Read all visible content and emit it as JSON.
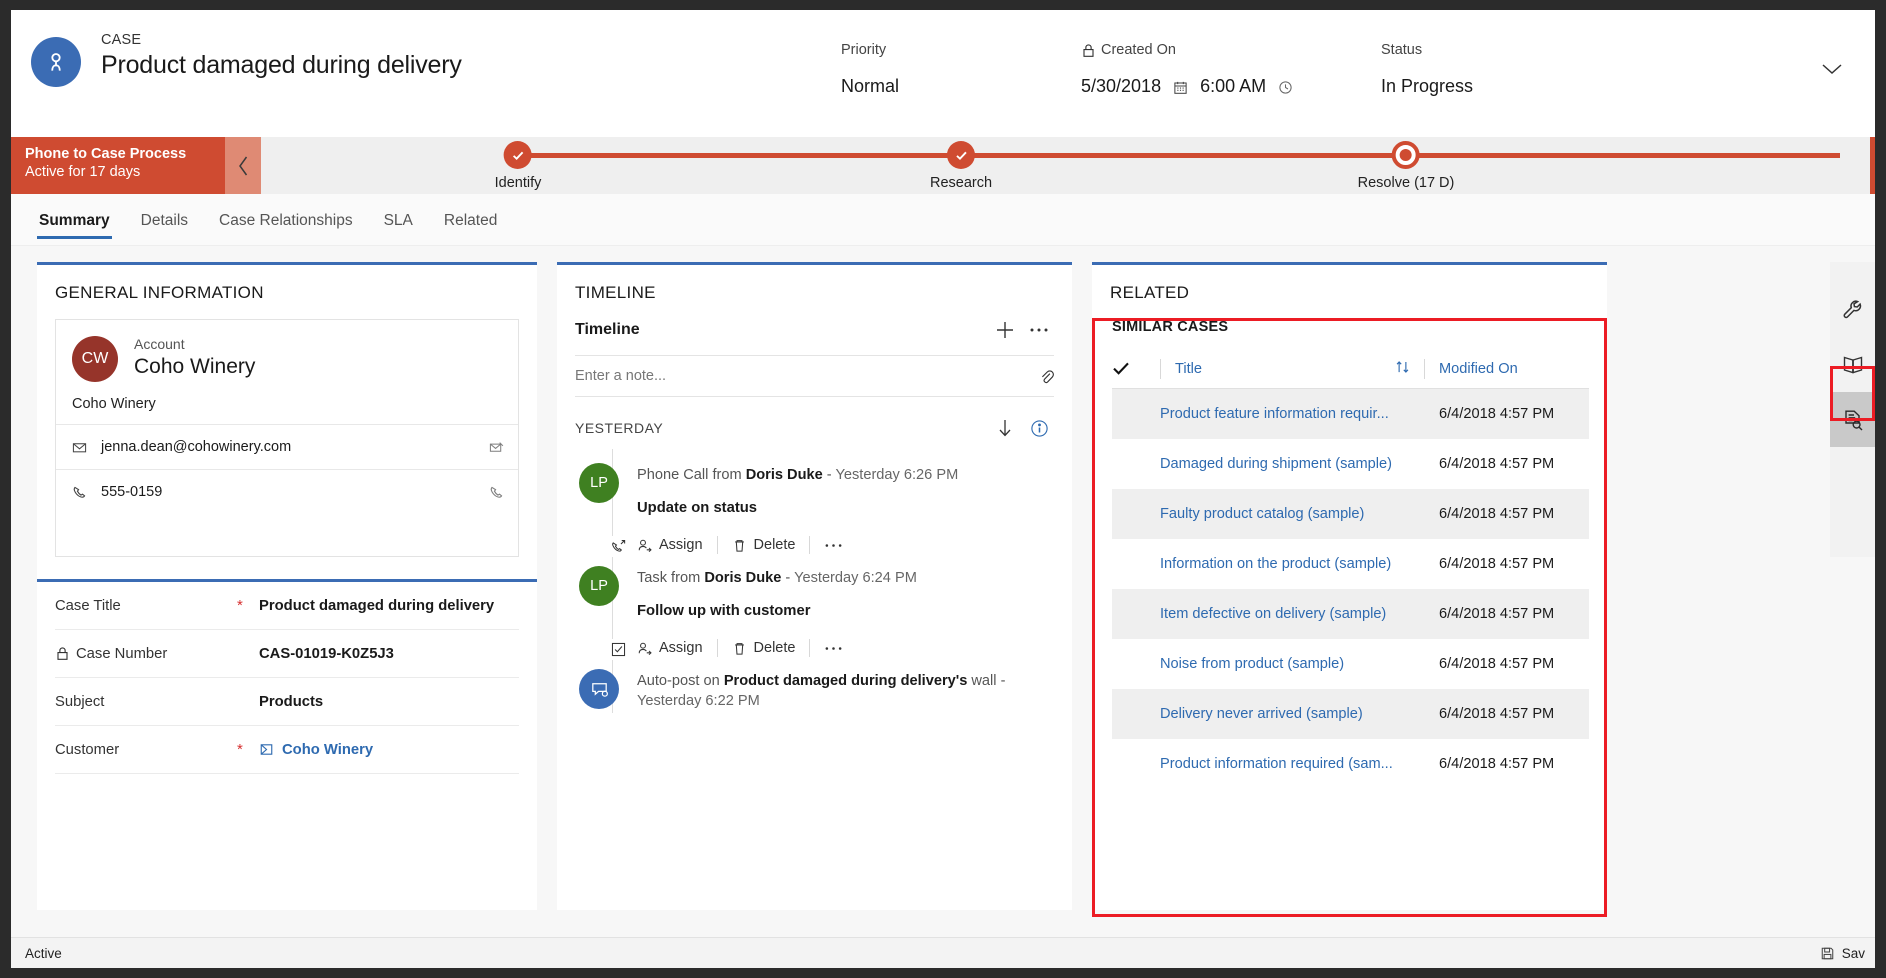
{
  "header": {
    "eyebrow": "CASE",
    "title": "Product damaged during delivery",
    "avatar_icon": "case-person-icon",
    "fields": {
      "priority_label": "Priority",
      "priority_value": "Normal",
      "created_label": "Created On",
      "created_date": "5/30/2018",
      "created_time": "6:00 AM",
      "status_label": "Status",
      "status_value": "In Progress"
    },
    "collapse_icon": "chevron-down-icon"
  },
  "process": {
    "name": "Phone to Case Process",
    "duration": "Active for 17 days",
    "collapse_icon": "chevron-left-icon",
    "accent_color": "#cf4b31",
    "stages": [
      {
        "label": "Identify",
        "state": "complete"
      },
      {
        "label": "Research",
        "state": "complete"
      },
      {
        "label": "Resolve  (17 D)",
        "state": "active"
      }
    ]
  },
  "tabs": [
    {
      "label": "Summary",
      "active": true
    },
    {
      "label": "Details",
      "active": false
    },
    {
      "label": "Case Relationships",
      "active": false
    },
    {
      "label": "SLA",
      "active": false
    },
    {
      "label": "Related",
      "active": false
    }
  ],
  "general_information": {
    "section_title": "GENERAL INFORMATION",
    "account": {
      "initials": "CW",
      "label": "Account",
      "name": "Coho Winery",
      "sub_name": "Coho Winery",
      "email": "jenna.dean@cohowinery.com",
      "phone": "555-0159",
      "email_icon": "envelope-icon",
      "email_action_icon": "send-email-icon",
      "phone_icon": "phone-icon",
      "phone_action_icon": "call-icon",
      "avatar_color": "#96342a"
    },
    "form_rows": [
      {
        "label": "Case Title",
        "required": true,
        "value": "Product damaged during delivery",
        "locked": false,
        "link": false
      },
      {
        "label": "Case Number",
        "required": false,
        "value": "CAS-01019-K0Z5J3",
        "locked": true,
        "link": false
      },
      {
        "label": "Subject",
        "required": false,
        "value": "Products",
        "locked": false,
        "link": false
      },
      {
        "label": "Customer",
        "required": true,
        "value": "Coho Winery",
        "locked": false,
        "link": true
      }
    ]
  },
  "timeline": {
    "section_title": "TIMELINE",
    "panel_title": "Timeline",
    "add_icon": "plus-icon",
    "more_icon": "ellipsis-icon",
    "note_placeholder": "Enter a note...",
    "attach_icon": "paperclip-icon",
    "day_group": "YESTERDAY",
    "sort_icon": "arrow-down-icon",
    "info_icon": "info-icon",
    "entries": [
      {
        "initials": "LP",
        "avatar_color": "#3f8021",
        "badge_icon": "phone-outgoing-icon",
        "prefix": "Phone Call from ",
        "actor": "Doris Duke",
        "dash": " - ",
        "time": "Yesterday 6:26 PM",
        "subject": "Update on status",
        "assign_label": "Assign",
        "delete_label": "Delete",
        "assign_icon": "assign-person-icon",
        "delete_icon": "trash-icon",
        "more_icon": "ellipsis-icon"
      },
      {
        "initials": "LP",
        "avatar_color": "#3f8021",
        "badge_icon": "task-checkbox-icon",
        "prefix": "Task from ",
        "actor": "Doris Duke",
        "dash": " - ",
        "time": "Yesterday 6:24 PM",
        "subject": "Follow up with customer",
        "assign_label": "Assign",
        "delete_label": "Delete",
        "assign_icon": "assign-person-icon",
        "delete_icon": "trash-icon",
        "more_icon": "ellipsis-icon"
      },
      {
        "initials": "",
        "avatar_color": "#3b6cb4",
        "badge_icon": "auto-post-icon",
        "prefix": "Auto-post on ",
        "actor": "Product damaged during delivery's",
        "dash": " wall - ",
        "time": "Yesterday 6:22 PM",
        "subject": "",
        "assign_label": "",
        "delete_label": "",
        "assign_icon": "",
        "delete_icon": "",
        "more_icon": ""
      }
    ]
  },
  "related": {
    "section_title": "RELATED",
    "similar_cases_title": "SIMILAR CASES",
    "columns": {
      "check_icon": "checkmark-icon",
      "title": "Title",
      "sort_icon": "sort-updown-icon",
      "modified_on": "Modified On"
    },
    "rows": [
      {
        "title": "Product feature information requir...",
        "modified_on": "6/4/2018 4:57 PM"
      },
      {
        "title": "Damaged during shipment (sample)",
        "modified_on": "6/4/2018 4:57 PM"
      },
      {
        "title": "Faulty product catalog (sample)",
        "modified_on": "6/4/2018 4:57 PM"
      },
      {
        "title": "Information on the product (sample)",
        "modified_on": "6/4/2018 4:57 PM"
      },
      {
        "title": "Item defective on delivery (sample)",
        "modified_on": "6/4/2018 4:57 PM"
      },
      {
        "title": "Noise from product (sample)",
        "modified_on": "6/4/2018 4:57 PM"
      },
      {
        "title": "Delivery never arrived (sample)",
        "modified_on": "6/4/2018 4:57 PM"
      },
      {
        "title": "Product information required (sam...",
        "modified_on": "6/4/2018 4:57 PM"
      }
    ],
    "highlight_color": "#ec1c24"
  },
  "side_rail": {
    "buttons": [
      {
        "icon": "wrench-icon",
        "selected": false
      },
      {
        "icon": "book-icon",
        "selected": false
      },
      {
        "icon": "document-search-icon",
        "selected": true
      }
    ]
  },
  "statusbar": {
    "state": "Active",
    "save_label": "Sav",
    "save_icon": "save-disk-icon"
  }
}
